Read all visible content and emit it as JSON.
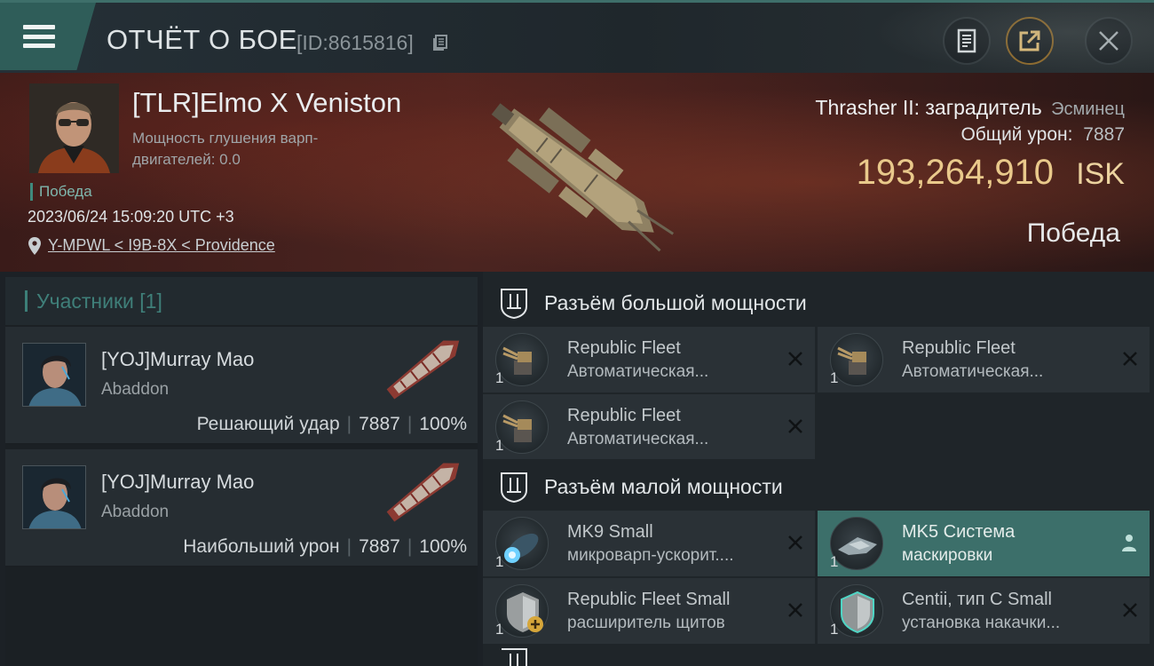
{
  "header": {
    "title": "ОТЧЁТ О БОЕ",
    "report_id": "[ID:8615816]",
    "icons": [
      "menu-icon",
      "copy-icon",
      "document-icon",
      "share-icon",
      "close-icon"
    ]
  },
  "summary": {
    "pilot_name": "[TLR]Elmo X Veniston",
    "scram_label": "Мощность глушения варп-двигателей: 0.0",
    "status_tag": "Победа",
    "datetime": "2023/06/24 15:09:20 UTC +3",
    "location": "Y-MPWL < I9B-8X < Providence",
    "ship_name": "Thrasher II: заградитель",
    "ship_class": "Эсминец",
    "damage_label": "Общий урон:",
    "damage_value": "7887",
    "isk_value": "193,264,910",
    "isk_unit": "ISK",
    "result": "Победа"
  },
  "participants": {
    "header": "Участники [1]",
    "rows": [
      {
        "name": "[YOJ]Murray Mao",
        "ship": "Abaddon",
        "role": "Решающий удар",
        "damage": "7887",
        "percent": "100%"
      },
      {
        "name": "[YOJ]Murray Mao",
        "ship": "Abaddon",
        "role": "Наибольший урон",
        "damage": "7887",
        "percent": "100%"
      }
    ]
  },
  "fittings": {
    "high_slots": {
      "label": "Разъём большой мощности",
      "modules": [
        {
          "line1": "Republic Fleet",
          "line2": "Автоматическая...",
          "qty": "1"
        },
        {
          "line1": "Republic Fleet",
          "line2": "Автоматическая...",
          "qty": "1"
        },
        {
          "line1": "Republic Fleet",
          "line2": "Автоматическая...",
          "qty": "1"
        }
      ]
    },
    "low_slots": {
      "label": "Разъём малой мощности",
      "modules": [
        {
          "line1": "MK9 Small",
          "line2": "микроварп-ускорит....",
          "qty": "1"
        },
        {
          "line1": "MK5 Система",
          "line2": "маскировки",
          "qty": "1"
        },
        {
          "line1": "Republic Fleet Small",
          "line2": "расширитель щитов",
          "qty": "1"
        },
        {
          "line1": "Centii, тип C Small",
          "line2": "установка накачки...",
          "qty": "1"
        }
      ]
    }
  },
  "colors": {
    "accent_teal": "#3c6f6a",
    "isk_gold": "#e9c98b",
    "hero_red": "#4b2420"
  }
}
